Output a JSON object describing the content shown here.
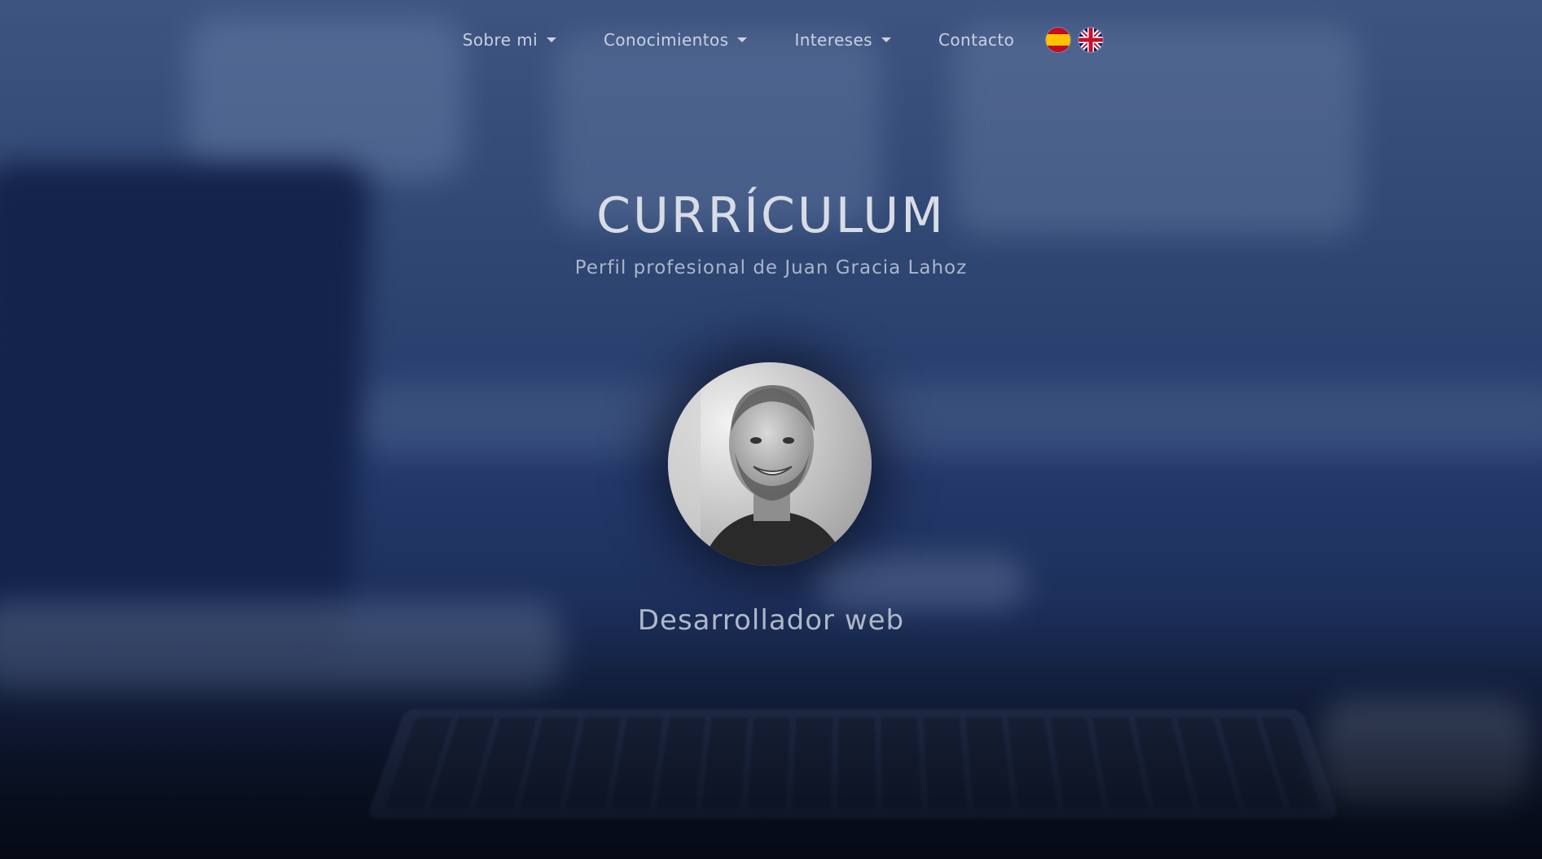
{
  "nav": {
    "items": [
      {
        "label": "Sobre mi",
        "dropdown": true
      },
      {
        "label": "Conocimientos",
        "dropdown": true
      },
      {
        "label": "Intereses",
        "dropdown": true
      },
      {
        "label": "Contacto",
        "dropdown": false
      }
    ],
    "languages": [
      {
        "icon": "spain-flag-icon"
      },
      {
        "icon": "uk-flag-icon"
      }
    ]
  },
  "hero": {
    "title": "CURRÍCULUM",
    "subtitle": "Perfil profesional de Juan Gracia Lahoz",
    "role": "Desarrollador web"
  },
  "colors": {
    "background": "#24396a",
    "nav_text": "#c9d1e0",
    "title_text": "#d7dce6"
  }
}
